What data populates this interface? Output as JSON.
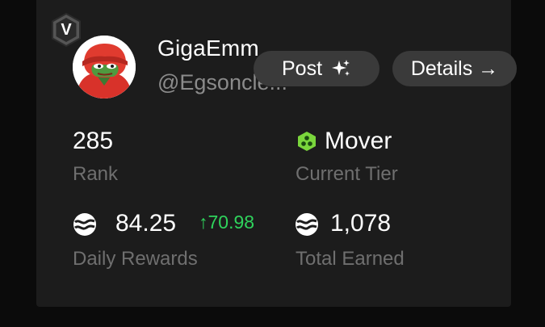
{
  "profile": {
    "badge_letter": "V",
    "name": "GigaEmm",
    "handle": "@Egsoncle..."
  },
  "actions": {
    "post_label": "Post",
    "details_label": "Details →"
  },
  "stats": {
    "rank_value": "285",
    "rank_label": "Rank",
    "tier_value": "Mover",
    "tier_label": "Current Tier",
    "daily_value": "84.25",
    "daily_delta": "↑70.98",
    "daily_label": "Daily Rewards",
    "total_value": "1,078",
    "total_label": "Total Earned"
  },
  "colors": {
    "background": "#0b0b0b",
    "card": "#1c1c1c",
    "pill": "#3a3a3a",
    "positive": "#2fd35c",
    "tier_green": "#7ad63c",
    "muted_text": "#6f6f6f"
  },
  "icons": {
    "badge": "hexagon-v-badge-icon",
    "post": "sparkle-icon",
    "tier": "green-hexagon-tier-icon",
    "coin": "coin-wave-icon"
  }
}
